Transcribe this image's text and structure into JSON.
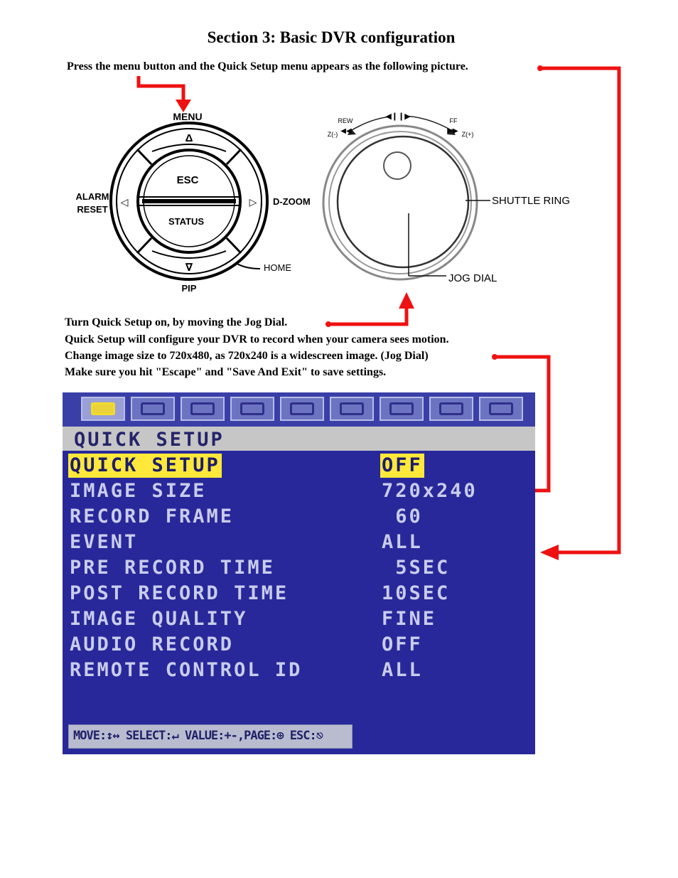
{
  "title": "Section 3: Basic DVR configuration",
  "intro": "Press the menu button and the Quick Setup menu appears as the following picture.",
  "remote": {
    "menu": "MENU",
    "esc": "ESC",
    "status": "STATUS",
    "alarm": "ALARM",
    "reset": "RESET",
    "dzoom": "D-ZOOM",
    "home": "HOME",
    "pip": "PIP",
    "up": "Δ",
    "down": "∇",
    "left": "◁",
    "right": "▷"
  },
  "dial": {
    "rew": "REW",
    "ff": "FF",
    "zminus": "Z(-)",
    "zplus": "Z(+)",
    "shuttle": "SHUTTLE RING",
    "jog": "JOG DIAL"
  },
  "instructions": [
    "Turn Quick Setup on, by moving the Jog Dial.",
    "Quick Setup will configure your DVR to record when your camera sees motion.",
    "Change image size to 720x480, as 720x240 is a widescreen image. (Jog Dial)",
    "Make sure you hit \"Escape\" and \"Save And Exit\" to save settings."
  ],
  "osd": {
    "header": "QUICK SETUP",
    "rows": [
      {
        "name": "QUICK SETUP",
        "value": "OFF"
      },
      {
        "name": "IMAGE SIZE",
        "value": "720x240"
      },
      {
        "name": "RECORD FRAME",
        "value": " 60"
      },
      {
        "name": "EVENT",
        "value": "ALL"
      },
      {
        "name": "PRE RECORD TIME",
        "value": " 5SEC"
      },
      {
        "name": "POST RECORD TIME",
        "value": "10SEC"
      },
      {
        "name": "IMAGE QUALITY",
        "value": "FINE"
      },
      {
        "name": "AUDIO RECORD",
        "value": "OFF"
      },
      {
        "name": "REMOTE CONTROL ID",
        "value": "ALL"
      }
    ],
    "footer": "MOVE:↕↔ SELECT:↵ VALUE:+-,PAGE:⊕ ESC:⎋",
    "tab_icons": [
      "quick-setup-icon",
      "display-icon",
      "record-icon",
      "event-icon",
      "camera-icon",
      "schedule-icon",
      "system-icon",
      "network-icon",
      "exit-icon"
    ]
  },
  "colors": {
    "arrow": "#ee1111",
    "osd_bg": "#28289a",
    "highlight": "#ffe83a"
  }
}
